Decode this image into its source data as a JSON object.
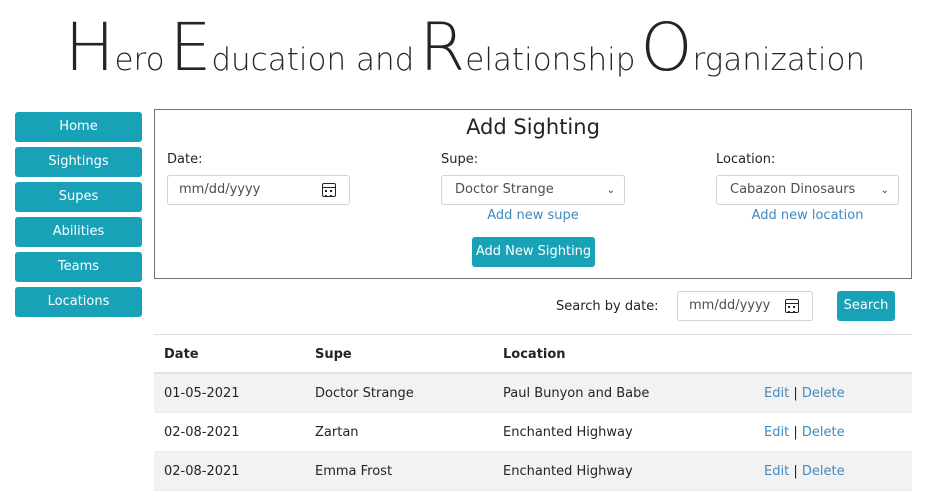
{
  "title": {
    "w1_initial": "H",
    "w1_rest": "ero",
    "w2_initial": "E",
    "w2_rest": "ducation and",
    "w3_initial": "R",
    "w3_rest": "elationship",
    "w4_initial": "O",
    "w4_rest": "rganization"
  },
  "sidebar": {
    "items": [
      {
        "label": "Home"
      },
      {
        "label": "Sightings"
      },
      {
        "label": "Supes"
      },
      {
        "label": "Abilities"
      },
      {
        "label": "Teams"
      },
      {
        "label": "Locations"
      }
    ]
  },
  "form": {
    "heading": "Add Sighting",
    "date_label": "Date:",
    "date_placeholder": "mm/dd/yyyy",
    "supe_label": "Supe:",
    "supe_selected": "Doctor Strange",
    "add_supe_link": "Add new supe",
    "location_label": "Location:",
    "location_selected": "Cabazon Dinosaurs",
    "add_location_link": "Add new location",
    "submit_label": "Add New Sighting"
  },
  "search": {
    "label": "Search by date:",
    "placeholder": "mm/dd/yyyy",
    "button_label": "Search"
  },
  "table": {
    "headers": [
      "Date",
      "Supe",
      "Location",
      ""
    ],
    "rows": [
      {
        "date": "01-05-2021",
        "supe": "Doctor Strange",
        "location": "Paul Bunyon and Babe",
        "edit": "Edit",
        "sep": "|",
        "delete": "Delete"
      },
      {
        "date": "02-08-2021",
        "supe": "Zartan",
        "location": "Enchanted Highway",
        "edit": "Edit",
        "sep": "|",
        "delete": "Delete"
      },
      {
        "date": "02-08-2021",
        "supe": "Emma Frost",
        "location": "Enchanted Highway",
        "edit": "Edit",
        "sep": "|",
        "delete": "Delete"
      }
    ]
  },
  "colors": {
    "accent": "#17a2b8",
    "link": "#3f8ac0",
    "stripe": "#f2f2f2"
  },
  "icons": {
    "calendar": "calendar-icon",
    "dropdown": "chevron-down-icon"
  }
}
